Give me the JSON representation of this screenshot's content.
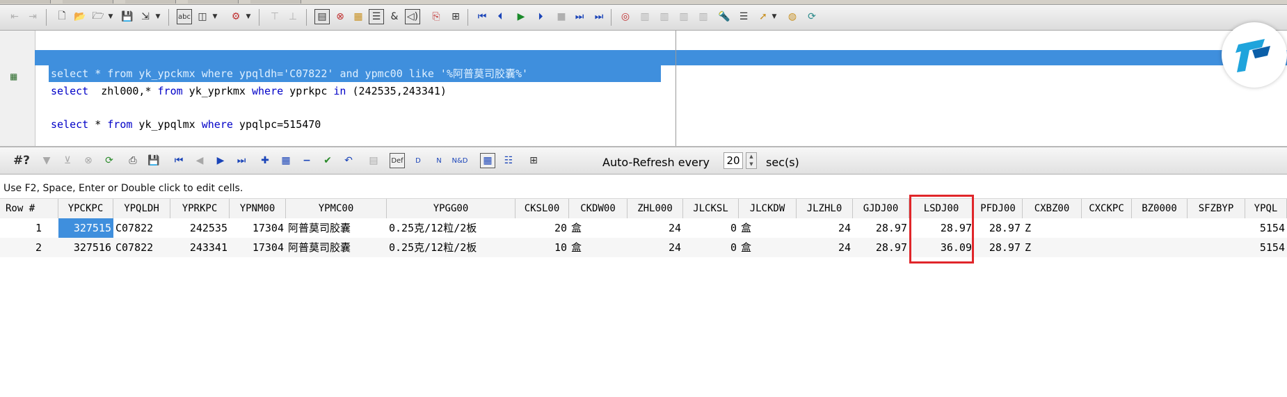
{
  "toolbar": {
    "buttons": [
      "new-document-icon",
      "open-folder-icon",
      "dropdown-icon",
      "save-icon",
      "save-all-icon",
      "dropdown-icon",
      "format-icon",
      "layout-icon",
      "dropdown-icon",
      "db-tools-icon",
      "dropdown-icon",
      "filter-icon",
      "sort-icon",
      "form-icon",
      "erase-icon",
      "table-icon",
      "list-icon",
      "ampersand-icon",
      "speaker-icon",
      "copy-icon",
      "grid-icon",
      "first-icon",
      "prev-icon",
      "play-icon",
      "step-icon",
      "stop-icon",
      "next-icon",
      "last-icon",
      "target-icon",
      "disabled-icon",
      "disabled-icon",
      "disabled-icon",
      "flashlight-icon",
      "bars-icon",
      "arrow-icon",
      "dropdown-icon",
      "globe-icon",
      "refresh-icon"
    ]
  },
  "editor": {
    "lines": [
      {
        "segments": [
          {
            "t": "select",
            "k": 1
          },
          {
            "t": " * ",
            "k": 0
          },
          {
            "t": "from",
            "k": 1
          },
          {
            "t": " yk_ypckmx ",
            "k": 0
          },
          {
            "t": "where",
            "k": 1
          },
          {
            "t": " ypqldh='C07822' ",
            "k": 0
          },
          {
            "t": "and",
            "k": 1
          },
          {
            "t": " ypmc00 ",
            "k": 0
          },
          {
            "t": "like",
            "k": 1
          },
          {
            "t": " '%阿普莫司胶囊%'",
            "k": 0
          }
        ],
        "selected": true
      },
      {
        "segments": [
          {
            "t": "select",
            "k": 1
          },
          {
            "t": "  zhl000,",
            "k": 0
          },
          {
            "t": "*",
            "k": 0
          },
          {
            "t": " ",
            "k": 0
          },
          {
            "t": "from",
            "k": 1
          },
          {
            "t": " yk_yprkmx ",
            "k": 0
          },
          {
            "t": "where",
            "k": 1
          },
          {
            "t": " yprkpc ",
            "k": 0
          },
          {
            "t": "in",
            "k": 1
          },
          {
            "t": " (242535,243341)",
            "k": 0
          }
        ],
        "selected": false
      },
      {
        "segments": [
          {
            "t": "select",
            "k": 1
          },
          {
            "t": " * ",
            "k": 0
          },
          {
            "t": "from",
            "k": 1
          },
          {
            "t": " yk_ypqlmx ",
            "k": 0
          },
          {
            "t": "where",
            "k": 1
          },
          {
            "t": " ypqlpc=515470",
            "k": 0
          }
        ],
        "selected": false
      }
    ]
  },
  "results_toolbar": {
    "query_label": "#?",
    "auto_refresh_label": "Auto-Refresh every",
    "auto_refresh_value": "20",
    "auto_refresh_unit": "sec(s)"
  },
  "hint": "Use F2, Space, Enter or Double click to edit cells.",
  "grid": {
    "columns": [
      "Row #",
      "YPCKPC",
      "YPQLDH",
      "YPRKPC",
      "YPNM00",
      "YPMC00",
      "YPGG00",
      "CKSL00",
      "CKDW00",
      "ZHL000",
      "JLCKSL",
      "JLCKDW",
      "JLZHL0",
      "GJDJ00",
      "LSDJ00",
      "PFDJ00",
      "CXBZ00",
      "CXCKPC",
      "BZ0000",
      "SFZBYP",
      "YPQL"
    ],
    "rows": [
      [
        "1",
        "327515",
        "C07822",
        "242535",
        "17304",
        "阿普莫司胶囊",
        "0.25克/12粒/2板",
        "20",
        "盒",
        "24",
        "0",
        "盒",
        "24",
        "28.97",
        "28.97",
        "28.97",
        "Z",
        "",
        "",
        "",
        "5154"
      ],
      [
        "2",
        "327516",
        "C07822",
        "243341",
        "17304",
        "阿普莫司胶囊",
        "0.25克/12粒/2板",
        "10",
        "盒",
        "24",
        "0",
        "盒",
        "24",
        "28.97",
        "36.09",
        "28.97",
        "Z",
        "",
        "",
        "",
        "5154"
      ]
    ],
    "highlighted_column": "LSDJ00",
    "selected_cell": "327515"
  }
}
